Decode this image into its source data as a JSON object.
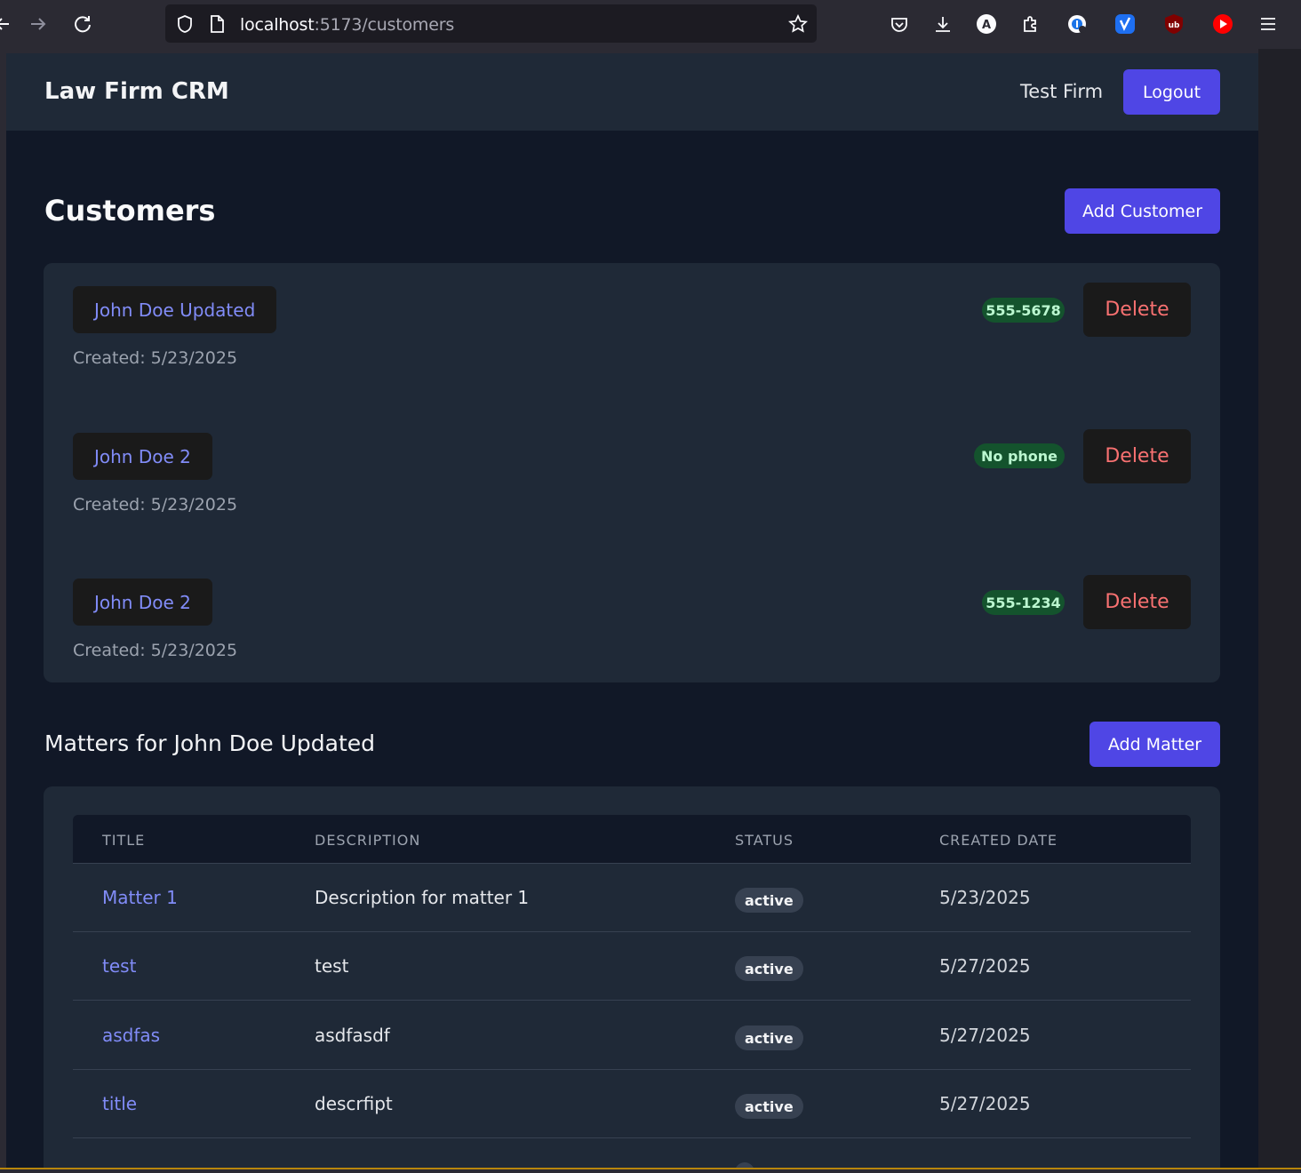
{
  "browser": {
    "url_host": "localhost",
    "url_rest": ":5173/customers"
  },
  "app": {
    "brand": "Law Firm CRM",
    "firm_name": "Test Firm",
    "logout_label": "Logout"
  },
  "customers": {
    "title": "Customers",
    "add_label": "Add Customer",
    "delete_label": "Delete",
    "items": [
      {
        "name": "John Doe Updated",
        "created": "Created: 5/23/2025",
        "phone": "555-5678"
      },
      {
        "name": "John Doe 2",
        "created": "Created: 5/23/2025",
        "phone": "No phone"
      },
      {
        "name": "John Doe 2",
        "created": "Created: 5/23/2025",
        "phone": "555-1234"
      }
    ]
  },
  "matters": {
    "title": "Matters for John Doe Updated",
    "add_label": "Add Matter",
    "columns": [
      "TITLE",
      "DESCRIPTION",
      "STATUS",
      "CREATED DATE"
    ],
    "rows": [
      {
        "title": "Matter 1",
        "description": "Description for matter 1",
        "status": "active",
        "date": "5/23/2025"
      },
      {
        "title": "test",
        "description": "test",
        "status": "active",
        "date": "5/27/2025"
      },
      {
        "title": "asdfas",
        "description": "asdfasdf",
        "status": "active",
        "date": "5/27/2025"
      },
      {
        "title": "title",
        "description": "descrfipt",
        "status": "active",
        "date": "5/27/2025"
      }
    ]
  },
  "colors": {
    "accent": "#4f46e5",
    "link": "#818cf8",
    "danger": "#f87171",
    "phone_badge_bg": "#14532d"
  }
}
